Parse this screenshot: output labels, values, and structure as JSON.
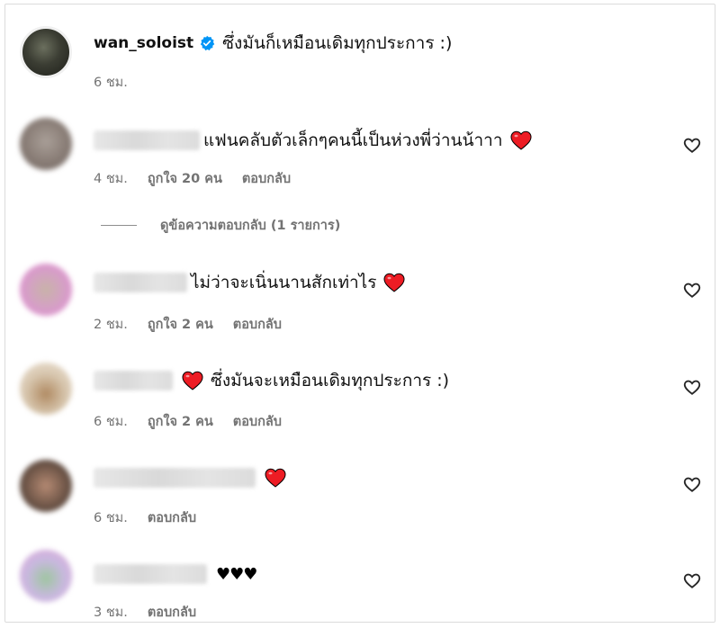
{
  "caption": {
    "username": "wan_soloist",
    "text": "ซึ่งมันก็เหมือนเดิมทุกประการ :)",
    "time": "6 ชม."
  },
  "colors": {
    "verified": "#0095f6",
    "heart": "#ed1c24",
    "meta": "#737373"
  },
  "comments": [
    {
      "text": "แฟนคลับตัวเล็กๆคนนี้เป็นห่วงพี่ว่านน้าาา",
      "time": "4 ชม.",
      "likes": "ถูกใจ 20 คน",
      "reply": "ตอบกลับ"
    },
    {
      "text": "ไม่ว่าจะเนิ่นนานสักเท่าไร",
      "time": "2 ชม.",
      "likes": "ถูกใจ 2 คน",
      "reply": "ตอบกลับ"
    },
    {
      "text": "ซึ่งมันจะเหมือนเดิมทุกประการ :)",
      "time": "6 ชม.",
      "likes": "ถูกใจ 2 คน",
      "reply": "ตอบกลับ"
    },
    {
      "text": "",
      "time": "6 ชม.",
      "reply": "ตอบกลับ"
    },
    {
      "text": "♥♥♥",
      "time": "3 ชม.",
      "reply": "ตอบกลับ"
    }
  ],
  "view_replies": "ดูข้อความตอบกลับ (1 รายการ)",
  "icons": {
    "verified": "verified-badge-icon",
    "like": "heart-outline-icon",
    "emoji": "red-heart-emoji-icon"
  }
}
